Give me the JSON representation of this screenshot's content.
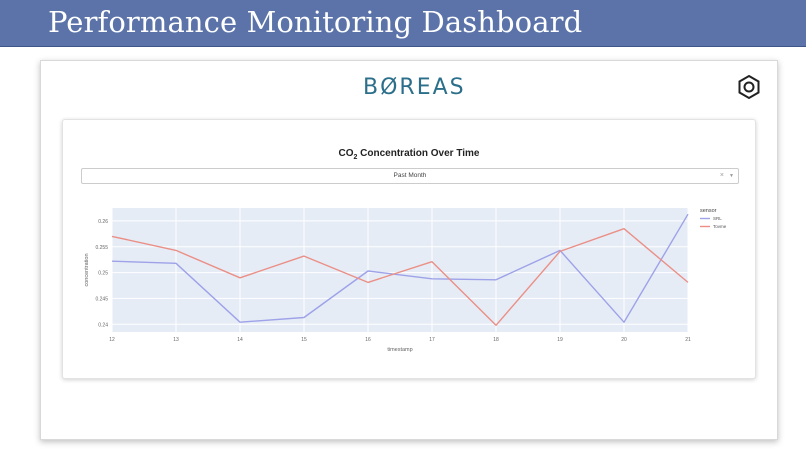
{
  "slide": {
    "title": "Performance Monitoring Dashboard"
  },
  "app": {
    "logo": "BØREAS",
    "settings_icon": "hexagon-nut-icon"
  },
  "filter": {
    "selected": "Past Month",
    "clear_glyph": "×",
    "arrow_glyph": "▼"
  },
  "colors": {
    "banner": "#5b73a8",
    "plot_bg": "#e5ecf6",
    "series_1": "#9ea2e8",
    "series_2": "#eb8f86",
    "logo": "#2c6f8a"
  },
  "chart_data": {
    "type": "line",
    "title": "CO2 Concentration Over Time",
    "xlabel": "timestamp",
    "ylabel": "concentration",
    "x": [
      12,
      13,
      14,
      15,
      16,
      17,
      18,
      19,
      20,
      21
    ],
    "x_ticks": [
      "12",
      "13",
      "14",
      "15",
      "16",
      "17",
      "18",
      "19",
      "20",
      "21"
    ],
    "y_ticks": [
      0.24,
      0.245,
      0.25,
      0.255,
      0.26
    ],
    "y_tick_labels": [
      "0.24",
      "0.245",
      "0.25",
      "0.255",
      "0.26"
    ],
    "ylim": [
      0.2385,
      0.2625
    ],
    "legend_title": "sensor",
    "legend_position": "right",
    "grid": true,
    "series": [
      {
        "name": "SRL",
        "color": "#9ea2e8",
        "values": [
          0.2522,
          0.2518,
          0.2404,
          0.2413,
          0.2503,
          0.2488,
          0.2486,
          0.2543,
          0.2404,
          0.2613
        ]
      },
      {
        "name": "Tovme",
        "color": "#eb8f86",
        "values": [
          0.257,
          0.2543,
          0.249,
          0.2532,
          0.2481,
          0.2521,
          0.2398,
          0.2541,
          0.2585,
          0.2481
        ]
      }
    ]
  }
}
